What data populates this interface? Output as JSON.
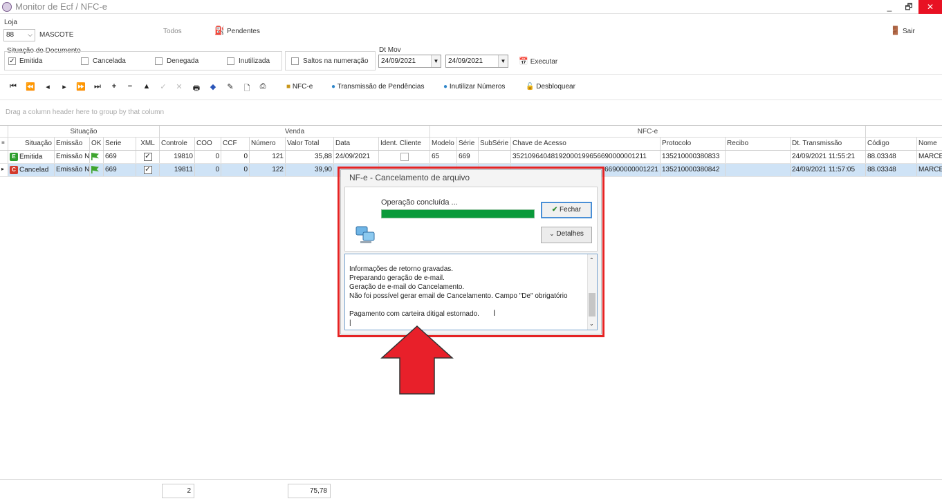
{
  "window": {
    "title": "Monitor de Ecf / NFC-e",
    "controls": [
      "_",
      "🗗",
      "✕"
    ]
  },
  "header": {
    "loja_label": "Loja",
    "loja_value": "88",
    "loja_name": "MASCOTE",
    "todos_label": "Todos",
    "pendentes_label": "Pendentes",
    "sair_label": "Sair"
  },
  "situacao": {
    "group_label": "Situação do Documento",
    "options": [
      {
        "label": "Emitida",
        "checked": true
      },
      {
        "label": "Cancelada",
        "checked": false
      },
      {
        "label": "Denegada",
        "checked": false
      },
      {
        "label": "Inutilizada",
        "checked": false
      }
    ],
    "saltos_label": "Saltos na numeração",
    "saltos_checked": false
  },
  "dtmov": {
    "label": "Dt Mov",
    "from": "24/09/2021",
    "to": "24/09/2021",
    "executar_label": "Executar"
  },
  "toolbar": {
    "nfce_label": "NFC-e",
    "transmissao_label": "Transmissão de Pendências",
    "inutilizar_label": "Inutilizar Números",
    "desbloquear_label": "Desbloquear"
  },
  "grid": {
    "group_hint": "Drag a column header here to group by that column",
    "bands": {
      "situacao": "Situação",
      "venda": "Venda",
      "nfce": "NFC-e"
    },
    "columns": [
      "Situação",
      "Emissão",
      "OK",
      "Serie",
      "XML",
      "Controle",
      "COO",
      "CCF",
      "Número",
      "Valor Total",
      "Data",
      "Ident. Cliente",
      "Modelo",
      "Série",
      "SubSérie",
      "Chave de Acesso",
      "Protocolo",
      "Recibo",
      "Dt. Transmissão",
      "Código",
      "Nome"
    ],
    "rows": [
      {
        "badge": "E",
        "badge_color": "#2e9e2e",
        "situacao": "Emitida",
        "emissao": "Emissão N",
        "serie": "669",
        "xml": true,
        "controle": "19810",
        "coo": "0",
        "ccf": "0",
        "numero": "121",
        "valor": "35,88",
        "data": "24/09/2021",
        "cliente": false,
        "modelo": "65",
        "serie2": "669",
        "subserie": "",
        "chave": "35210964048192000199656690000001211",
        "protocolo": "135210000380833",
        "recibo": "",
        "dt_trans": "24/09/2021 11:55:21",
        "codigo": "88.03348",
        "nome": "MARCE"
      },
      {
        "badge": "C",
        "badge_color": "#d33a2c",
        "situacao": "Cancelad",
        "emissao": "Emissão N",
        "serie": "669",
        "xml": true,
        "controle": "19811",
        "coo": "0",
        "ccf": "0",
        "numero": "122",
        "valor": "39,90",
        "data": "",
        "cliente": false,
        "modelo": "",
        "serie2": "",
        "subserie": "",
        "chave": "66900000001221",
        "protocolo": "135210000380842",
        "recibo": "",
        "dt_trans": "24/09/2021 11:57:05",
        "codigo": "88.03348",
        "nome": "MARCE"
      }
    ]
  },
  "footer": {
    "count": "2",
    "total": "75,78"
  },
  "dialog": {
    "title": "NF-e - Cancelamento de arquivo",
    "status": "Operação concluída ...",
    "progress": 1.0,
    "fechar_label": "Fechar",
    "detalhes_label": "Detalhes",
    "log": [
      "Informações de retorno gravadas.",
      "Preparando geração de e-mail.",
      "Geração de e-mail do Cancelamento.",
      "Não foi possível gerar email de Cancelamento. Campo \"De\" obrigatório",
      "",
      "Pagamento com carteira ditigal estornado."
    ]
  },
  "colors": {
    "highlight": "#e52323",
    "progress": "#0a9a3a",
    "selected_row": "#cfe3f6"
  }
}
